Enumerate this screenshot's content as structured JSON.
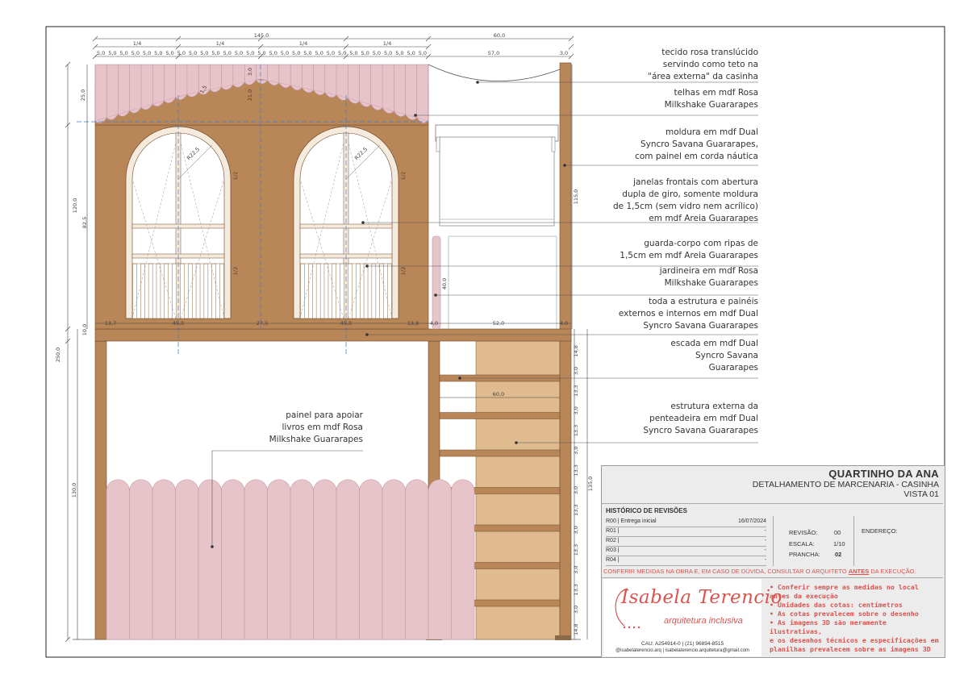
{
  "project": {
    "title": "QUARTINHO DA ANA",
    "subtitle": "DETALHAMENTO DE MARCENARIA - CASINHA",
    "view": "VISTA 01"
  },
  "revisions": {
    "heading": "HISTÓRICO DE REVISÕES",
    "rows": [
      {
        "code": "R00 |",
        "desc": "Entrega inicial",
        "date": "16/07/2024"
      },
      {
        "code": "R01 |",
        "desc": "",
        "date": "-"
      },
      {
        "code": "R02 |",
        "desc": "",
        "date": "-"
      },
      {
        "code": "R03 |",
        "desc": "",
        "date": "-"
      },
      {
        "code": "R04 |",
        "desc": "",
        "date": "-"
      }
    ]
  },
  "sheet_info": {
    "revisao_label": "REVISÃO:",
    "revisao": "00",
    "escala_label": "ESCALA:",
    "escala": "1/10",
    "prancha_label": "PRANCHA:",
    "prancha": "02",
    "endereco_label": "ENDEREÇO:"
  },
  "warning": {
    "before": "CONFERIR MEDIDAS NA OBRA E, EM CASO DE DÚVIDA, CONSULTAR O ARQUITETO ",
    "emph": "ANTES",
    "after": " DA EXECUÇÃO."
  },
  "notes": [
    "• Conferir sempre as medidas no local",
    "antes da execução",
    "• Unidades das cotas: centímetros",
    "• As cotas prevalecem sobre o desenho",
    "• As imagens 3D são meramente ilustrativas,",
    "e os desenhos técnicos e especificações em",
    "planilhas prevalecem sobre as imagens 3D"
  ],
  "logo": {
    "name": "Isabela Terencio",
    "tagline": "arquitetura inclusiva",
    "cau": "CAU: A254914-0 | (21) 96894-8515",
    "contact": "@isabelaterencio.arq | isabelaterencio.arquitetura@gmail.com"
  },
  "annotations": [
    [
      "tecido rosa translúcido",
      "servindo como teto na",
      "\"área externa\" da casinha"
    ],
    [
      "telhas em mdf Rosa",
      "Milkshake Guararapes"
    ],
    [
      "moldura em mdf Dual",
      "Syncro Savana Guararapes,",
      "com painel em corda náutica"
    ],
    [
      "janelas frontais com abertura",
      "dupla de giro, somente moldura",
      "de 1,5cm (sem vidro nem acrílico)",
      "em mdf Areia Guararapes"
    ],
    [
      "guarda-corpo com ripas de",
      "1,5cm em mdf Areia Guararapes"
    ],
    [
      "jardineira em mdf Rosa",
      "Milkshake Guararapes"
    ],
    [
      "toda a estrutura e painéis",
      "externos e internos em mdf Dual",
      "Syncro Savana Guararapes"
    ],
    [
      "escada em mdf Dual",
      "Syncro Savana",
      "Guararapes"
    ],
    [
      "estrutura externa da",
      "penteadeira em mdf Dual",
      "Syncro Savana Guararapes"
    ],
    [
      "painel para apoiar",
      "livros em mdf Rosa",
      "Milkshake Guararapes"
    ]
  ],
  "dimensions": {
    "top_total": "145,0",
    "top_right": "60,0",
    "quarters": [
      "1/4",
      "1/4",
      "1/4",
      "1/4"
    ],
    "tile": "5,0",
    "fabric_span": "57,0",
    "post": "3,0",
    "roof_height": "25,0",
    "roof_inner": "21,0",
    "roof_slope": "1,5",
    "upper_height": "120,0",
    "window_height": "82,5",
    "floor_thickness": "10,0",
    "total_height": "250,0",
    "lower_height": "130,0",
    "right_post_height": "115,0",
    "half": "1/2",
    "window_radius": "R22,5",
    "bottom_row": [
      "13,7",
      "45,0",
      "27,5",
      "45,0",
      "13,8"
    ],
    "planter_w": "4,0",
    "deck": "52,0",
    "deck_post": "4,0",
    "planter_h": "40,0",
    "ladder_width": "60,0",
    "ladder_total": "135,0",
    "ladder_steps": [
      "14,8",
      "3,0",
      "13,3",
      "3,0",
      "13,3",
      "3,0",
      "13,3",
      "3,0",
      "13,3",
      "3,0",
      "13,3",
      "3,0",
      "13,3",
      "3,0",
      "14,8"
    ]
  },
  "colors": {
    "structure": "#b98658",
    "pink": "#e7c3ca",
    "sand": "#dfbb8f",
    "accent_red": "#d9534f"
  }
}
